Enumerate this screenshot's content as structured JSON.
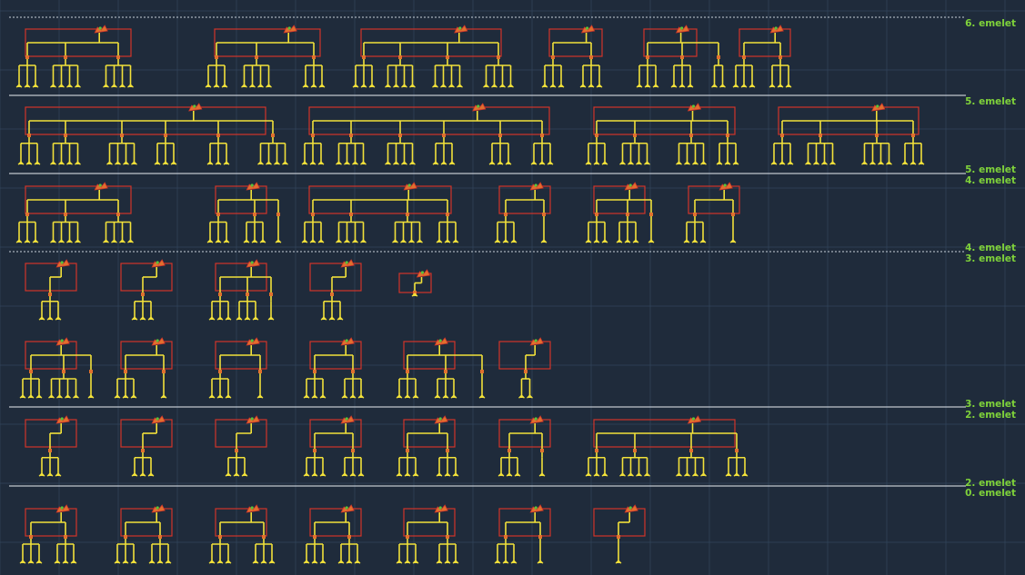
{
  "drawing": {
    "colors": {
      "background": "#1f2b3b",
      "grid": "#33465d",
      "floor_line": "#e8ecf2",
      "floor_line_dashed": "#c9d0da",
      "pipe": "#f2e13a",
      "zone_box": "#d2352a",
      "riser": "#e0702e",
      "riser_accent": "#5cc23a",
      "label": "#7fd23a"
    },
    "floor_labels": [
      "6. emelet",
      "5. emelet",
      "5. emelet",
      "4. emelet",
      "4. emelet",
      "3. emelet",
      "3. emelet",
      "2. emelet",
      "2. emelet",
      "0. emelet"
    ]
  }
}
